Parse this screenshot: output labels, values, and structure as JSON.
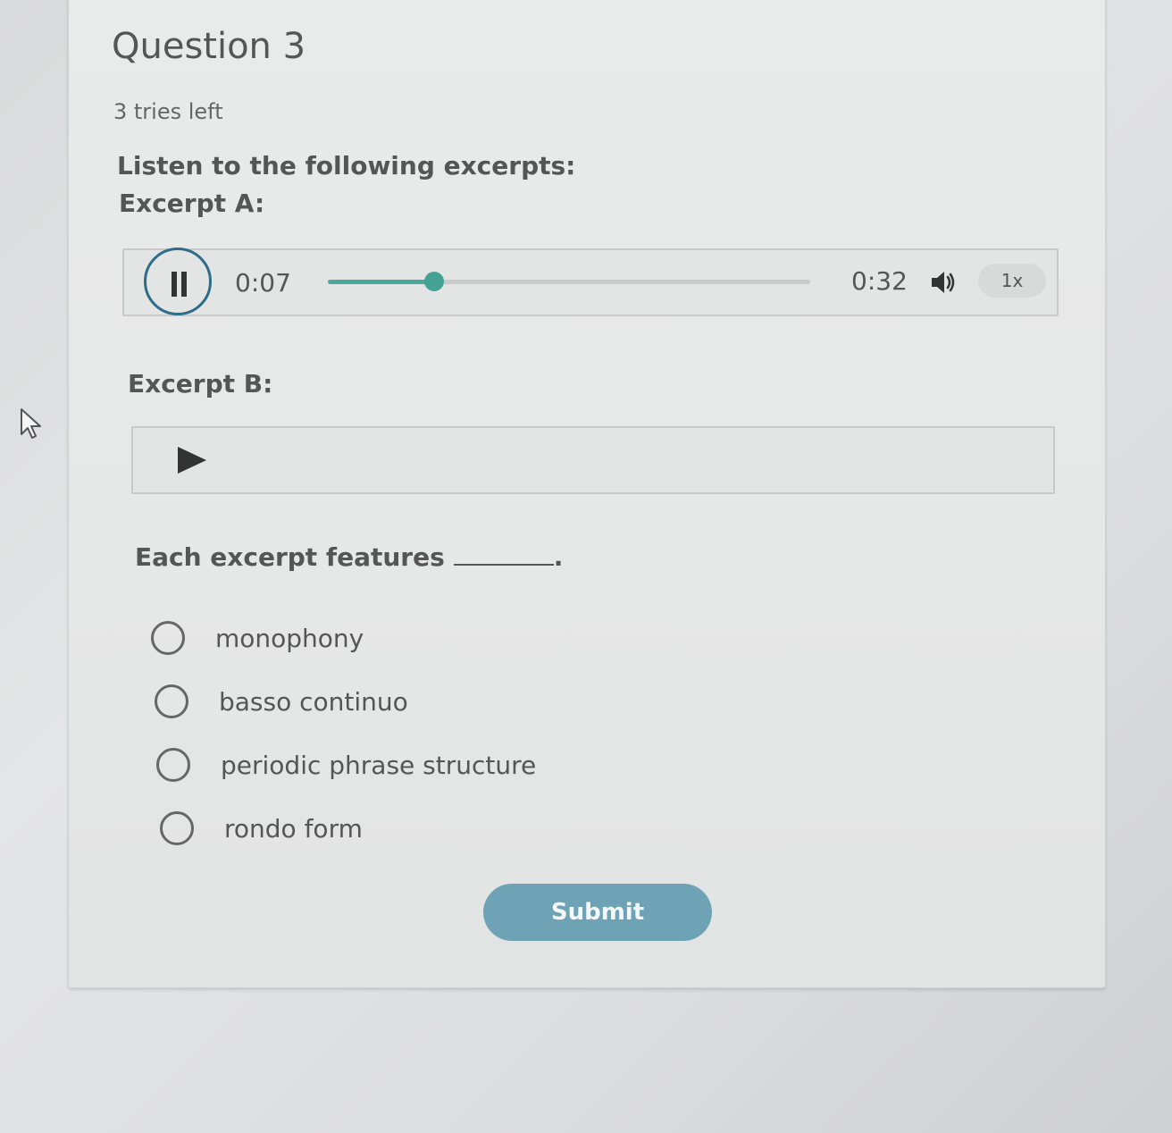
{
  "question": {
    "title": "Question 3",
    "tries_left": "3 tries left",
    "instructions": "Listen to the following excerpts:",
    "prompt": "Each excerpt features",
    "prompt_end": "."
  },
  "excerpt_a": {
    "label": "Excerpt A:",
    "current_time": "0:07",
    "total_time": "0:32",
    "progress": 0.22,
    "speed": "1x",
    "state": "playing"
  },
  "excerpt_b": {
    "label": "Excerpt B:",
    "state": "paused"
  },
  "options": [
    {
      "label": "monophony"
    },
    {
      "label": "basso continuo"
    },
    {
      "label": "periodic phrase structure"
    },
    {
      "label": "rondo form"
    }
  ],
  "submit_label": "Submit",
  "colors": {
    "accent": "#44a295",
    "pause_ring": "#2f6c8a",
    "submit": "#6ea3b5"
  },
  "icons": {
    "pause": "pause-icon",
    "play": "play-icon",
    "volume": "volume-icon",
    "cursor": "mouse-pointer-icon"
  }
}
